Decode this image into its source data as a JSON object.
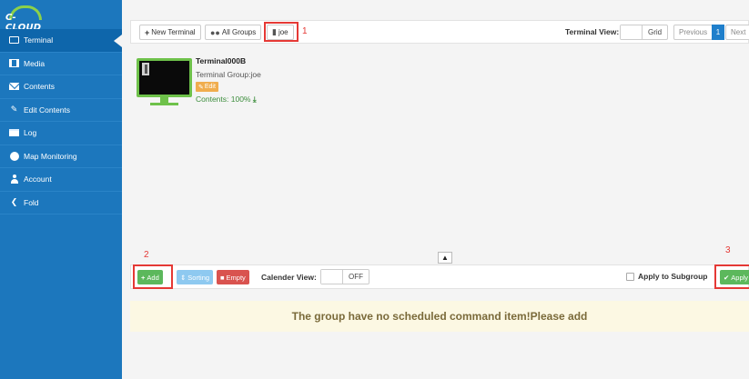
{
  "app": {
    "logo_text": "C-CLOUD"
  },
  "sidebar": {
    "items": [
      {
        "label": "Terminal",
        "icon": "monitor-icon",
        "active": true
      },
      {
        "label": "Media",
        "icon": "film-icon"
      },
      {
        "label": "Contents",
        "icon": "envelope-icon"
      },
      {
        "label": "Edit Contents",
        "icon": "edit-icon"
      },
      {
        "label": "Log",
        "icon": "list-icon"
      },
      {
        "label": "Map Monitoring",
        "icon": "globe-icon"
      },
      {
        "label": "Account",
        "icon": "user-icon"
      },
      {
        "label": "Fold",
        "icon": "chevron-left-icon"
      }
    ]
  },
  "toolbar": {
    "new_terminal": "New Terminal",
    "all_groups": "All Groups",
    "group_joe": "joe",
    "terminal_view_label": "Terminal View:",
    "terminal_view_value": "Grid",
    "previous": "Previous",
    "page": "1",
    "next": "Next"
  },
  "annotations": {
    "a1": "1",
    "a2": "2",
    "a3": "3"
  },
  "terminal": {
    "name": "Terminal000B",
    "group": "Terminal Group:joe",
    "edit": "Edit",
    "contents": "Contents: 100%"
  },
  "schedule": {
    "add": "Add",
    "sorting": "Sorting",
    "empty": "Empty",
    "calendar_label": "Calender View:",
    "calendar_value": "OFF",
    "apply_subgroup": "Apply to Subgroup",
    "apply": "Apply",
    "notice": "The group have no scheduled command item!Please add"
  },
  "colors": {
    "sidebar": "#1c77bd",
    "add": "#5cb85c",
    "sorting": "#8ec9f0",
    "empty": "#d9534f",
    "apply": "#5cb85c",
    "highlight": "#e53935"
  }
}
